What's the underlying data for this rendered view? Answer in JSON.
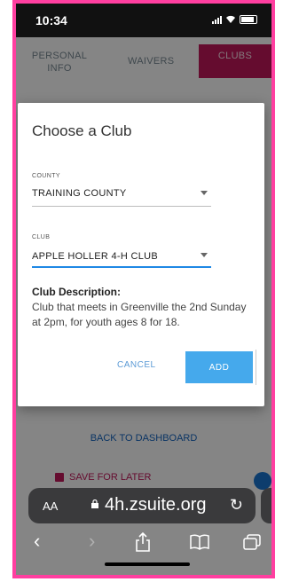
{
  "status": {
    "time": "10:34"
  },
  "tabs": {
    "personal": "PERSONAL INFO",
    "waivers": "WAIVERS",
    "clubs": "CLUBS"
  },
  "background": {
    "back_label": "BACK TO DASHBOARD",
    "save_label": "SAVE FOR LATER"
  },
  "dialog": {
    "title": "Choose a Club",
    "county": {
      "label": "COUNTY",
      "value": "TRAINING COUNTY"
    },
    "club": {
      "label": "CLUB",
      "value": "APPLE HOLLER 4-H CLUB"
    },
    "description_heading": "Club Description:",
    "description_text": "Club that meets in Greenville the 2nd Sunday at 2pm, for youth ages 8 for 18.",
    "cancel_label": "CANCEL",
    "add_label": "ADD"
  },
  "browser": {
    "text_size_label": "AA",
    "url": "4h.zsuite.org"
  },
  "colors": {
    "accent_pink": "#c2185b",
    "button_blue": "#45a9ec",
    "frame": "#ff3fa0"
  },
  "icons": [
    "lock-icon",
    "reload-icon",
    "back-icon",
    "forward-icon",
    "share-icon",
    "bookmarks-icon",
    "tabs-icon"
  ]
}
